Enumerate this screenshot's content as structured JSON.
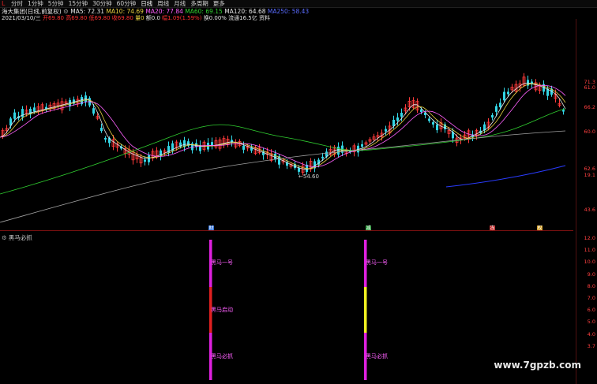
{
  "toolbar": {
    "mode_label": "L",
    "tabs": [
      "分时",
      "1分钟",
      "5分钟",
      "15分钟",
      "30分钟",
      "60分钟",
      "日线",
      "周线",
      "月线",
      "多周期",
      "更多"
    ],
    "active_tab_index": 6
  },
  "info_line1": {
    "name": "海大集团(日线,前复权)",
    "ma5": "MA5: 72.31",
    "ma10": "MA10: 74.69",
    "ma20": "MA20: 77.84",
    "ma60": "MA60: 69.15",
    "ma120": "MA120: 64.68",
    "ma250": "MA250: 58.43"
  },
  "info_line2": {
    "date": "2021/03/10/三",
    "open": "开69.80",
    "high": "高69.80",
    "low": "低69.80",
    "close": "收69.80",
    "volume": "量0",
    "change": "额0.0",
    "pct": "幅1.09(1.59%)",
    "turnover": "换0.00%",
    "float_cap": "流通16.5亿",
    "extra": "资料"
  },
  "price_axis": [
    "71.3",
    "61.0",
    "66.2",
    "60.0",
    "62.6",
    "19.1",
    "43.6"
  ],
  "low_annotation": "54.60",
  "event_markers": [
    {
      "label": "财",
      "color": "#2e6fd8"
    },
    {
      "label": "减",
      "color": "#2a9a3a"
    },
    {
      "label": "冻",
      "color": "#c03030"
    },
    {
      "label": "权",
      "color": "#d09a20"
    }
  ],
  "indicator": {
    "title": "黑马必抓",
    "axis": [
      "12.0",
      "11.0",
      "10.0",
      "9.0",
      "8.0",
      "7.0",
      "6.0",
      "5.0",
      "4.0",
      "3.7"
    ],
    "signal1": {
      "top": "黑马一号",
      "mid": "黑马启动",
      "bottom": "黑马必抓"
    },
    "signal2": {
      "top": "黑马一号",
      "bottom": "黑马必抓"
    }
  },
  "watermark": "www.7gpzb.com",
  "colors": {
    "candle_up": "#ff3a3a",
    "candle_down": "#33d6e6",
    "ma5": "#e6e6e6",
    "ma10": "#e8d040",
    "ma20": "#ff60ff",
    "ma60": "#30d030",
    "ma120": "#a0a0a0",
    "ma250": "#2a3cff",
    "bar_magenta": "#e020e0",
    "bar_red": "#e02020",
    "bar_yellow": "#f0f020"
  }
}
